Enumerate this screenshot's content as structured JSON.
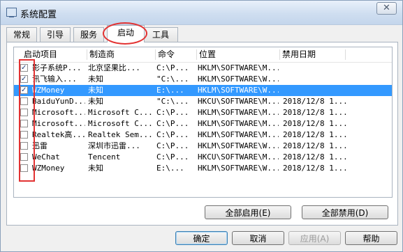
{
  "window": {
    "title": "系统配置",
    "close_glyph": "✕"
  },
  "tabs": [
    {
      "label": "常规"
    },
    {
      "label": "引导"
    },
    {
      "label": "服务"
    },
    {
      "label": "启动"
    },
    {
      "label": "工具"
    }
  ],
  "list": {
    "columns": [
      "启动项目",
      "制造商",
      "命令",
      "位置",
      "禁用日期"
    ],
    "rows": [
      {
        "checked": true,
        "item": "影子系统P...",
        "maker": "北京坚果比...",
        "cmd": "C:\\P...",
        "loc": "HKLM\\SOFTWARE\\M...",
        "date": ""
      },
      {
        "checked": true,
        "item": "讯飞输入...",
        "maker": "未知",
        "cmd": "\"C:\\...",
        "loc": "HKLM\\SOFTWARE\\W...",
        "date": ""
      },
      {
        "checked": true,
        "item": "WZMoney",
        "maker": "未知",
        "cmd": "E:\\...",
        "loc": "HKLM\\SOFTWARE\\W...",
        "date": ""
      },
      {
        "checked": false,
        "item": "BaiduYunD...",
        "maker": "未知",
        "cmd": "\"C:\\...",
        "loc": "HKCU\\SOFTWARE\\M...",
        "date": "2018/12/8 1..."
      },
      {
        "checked": false,
        "item": "Microsoft...",
        "maker": "Microsoft C...",
        "cmd": "C:\\P...",
        "loc": "HKLM\\SOFTWARE\\M...",
        "date": "2018/12/8 1..."
      },
      {
        "checked": false,
        "item": "Microsoft...",
        "maker": "Microsoft C...",
        "cmd": "C:\\P...",
        "loc": "HKLM\\SOFTWARE\\M...",
        "date": "2018/12/8 1..."
      },
      {
        "checked": false,
        "item": "Realtek高...",
        "maker": "Realtek Sem...",
        "cmd": "C:\\P...",
        "loc": "HKLM\\SOFTWARE\\M...",
        "date": "2018/12/8 1..."
      },
      {
        "checked": false,
        "item": "迅雷",
        "maker": "深圳市迅雷...",
        "cmd": "C:\\P...",
        "loc": "HKLM\\SOFTWARE\\W...",
        "date": "2018/12/8 1..."
      },
      {
        "checked": false,
        "item": "WeChat",
        "maker": "Tencent",
        "cmd": "C:\\P...",
        "loc": "HKCU\\SOFTWARE\\M...",
        "date": "2018/12/8 1..."
      },
      {
        "checked": false,
        "item": "WZMoney",
        "maker": "未知",
        "cmd": "E:\\...",
        "loc": "HKLM\\SOFTWARE\\W...",
        "date": "2018/12/8 1..."
      }
    ],
    "selected_row": 2
  },
  "buttons": {
    "enable_all": "全部启用(E)",
    "disable_all": "全部禁用(D)",
    "ok": "确定",
    "cancel": "取消",
    "apply": "应用(A)",
    "help": "帮助"
  },
  "colors": {
    "selection": "#3399ff",
    "annotation": "#e23232"
  }
}
